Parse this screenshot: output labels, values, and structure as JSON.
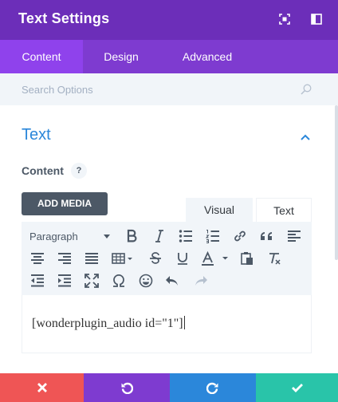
{
  "header": {
    "title": "Text Settings",
    "icons": [
      "expand-icon",
      "sidebar-toggle-icon"
    ]
  },
  "tabs": [
    {
      "label": "Content",
      "active": true
    },
    {
      "label": "Design",
      "active": false
    },
    {
      "label": "Advanced",
      "active": false
    }
  ],
  "search": {
    "placeholder": "Search Options",
    "icon": "search-icon"
  },
  "section": {
    "title": "Text",
    "expanded": true
  },
  "content_field": {
    "label": "Content",
    "help": "?",
    "add_media_label": "ADD MEDIA",
    "editor_tabs": [
      {
        "label": "Visual",
        "active": true
      },
      {
        "label": "Text",
        "active": false
      }
    ],
    "format_select": "Paragraph",
    "value": "[wonderplugin_audio id=\"1\"]"
  },
  "colors": {
    "header_bg": "#6c2eb9",
    "tabs_bg": "#7e3bd0",
    "tab_active_bg": "#8f42ec",
    "accent": "#2b87da",
    "cancel": "#ef5555",
    "undo": "#7e3bd0",
    "redo": "#2b87da",
    "save": "#29c4a9"
  },
  "footer": {
    "buttons": [
      "close-icon",
      "undo-icon",
      "redo-icon",
      "checkmark-icon"
    ]
  }
}
